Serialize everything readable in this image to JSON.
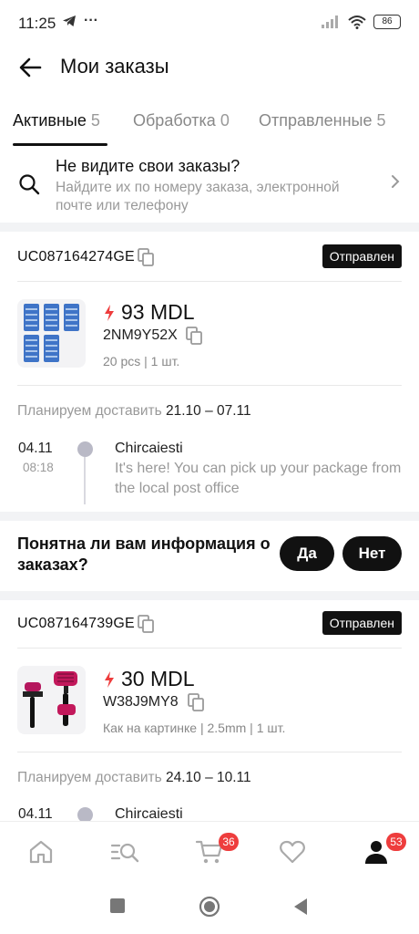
{
  "status_bar": {
    "time": "11:25",
    "battery": "86",
    "more": "···"
  },
  "header": {
    "title": "Мои заказы"
  },
  "tabs": [
    {
      "label": "Активные",
      "count": "5"
    },
    {
      "label": "Обработка",
      "count": "0"
    },
    {
      "label": "Отправленные",
      "count": "5"
    }
  ],
  "search_hint": {
    "title": "Не видите свои заказы?",
    "subtitle": "Найдите их по номеру заказа, электронной почте или телефону"
  },
  "orders": [
    {
      "id": "UC087164274GE",
      "status": "Отправлен",
      "price": "93 MDL",
      "sku": "2NM9Y52X",
      "variant": "20 pcs | 1 шт.",
      "delivery_label": "Планируем доставить",
      "delivery_dates": "21.10 – 07.11",
      "tracking": {
        "date": "04.11",
        "time": "08:18",
        "place": "Chircaiesti",
        "description": "It's here! You can pick up your package from the local post office"
      }
    },
    {
      "id": "UC087164739GE",
      "status": "Отправлен",
      "price": "30 MDL",
      "sku": "W38J9MY8",
      "variant": "Как на картинке | 2.5mm | 1 шт.",
      "delivery_label": "Планируем доставить",
      "delivery_dates": "24.10 – 10.11",
      "tracking": {
        "date": "04.11",
        "place": "Chircaiesti"
      }
    }
  ],
  "feedback": {
    "question": "Понятна ли вам информация о заказах?",
    "yes": "Да",
    "no": "Нет"
  },
  "bottom_nav": {
    "items": [
      "home-icon",
      "catalog-search-icon",
      "cart-icon",
      "heart-icon",
      "profile-icon"
    ],
    "cart_badge": "36",
    "profile_badge": "53"
  },
  "colors": {
    "accent_red": "#ee3d3d",
    "dark": "#111111",
    "muted": "#999999"
  }
}
